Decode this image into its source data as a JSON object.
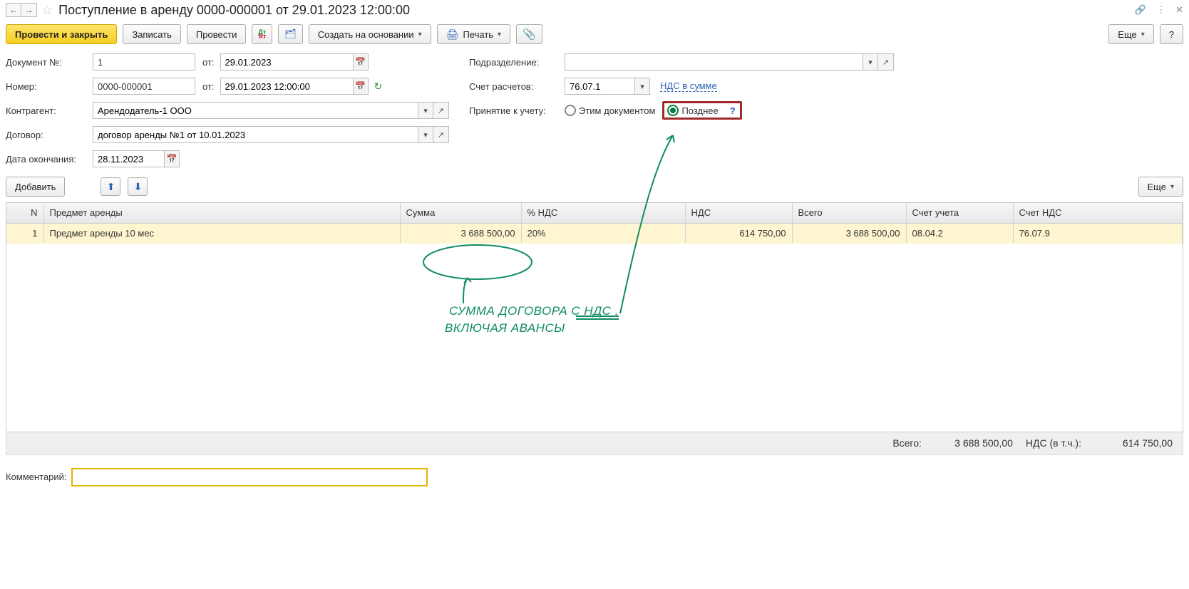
{
  "title": "Поступление в аренду 0000-000001 от 29.01.2023 12:00:00",
  "toolbar": {
    "post_close": "Провести и закрыть",
    "save": "Записать",
    "post": "Провести",
    "create_based": "Создать на основании",
    "print": "Печать",
    "more": "Еще",
    "help": "?"
  },
  "form": {
    "doc_no_label": "Документ №:",
    "doc_no": "1",
    "from_label": "от:",
    "doc_date": "29.01.2023",
    "number_label": "Номер:",
    "number": "0000-000001",
    "number_date": "29.01.2023 12:00:00",
    "counterparty_label": "Контрагент:",
    "counterparty": "Арендодатель-1 ООО",
    "contract_label": "Договор:",
    "contract": "договор аренды №1 от 10.01.2023",
    "end_date_label": "Дата окончания:",
    "end_date": "28.11.2023",
    "division_label": "Подразделение:",
    "division": "",
    "account_label": "Счет расчетов:",
    "account": "76.07.1",
    "vat_link": "НДС в сумме",
    "accept_label": "Принятие к учету:",
    "radio_this_doc": "Этим документом",
    "radio_later": "Позднее"
  },
  "row_toolbar": {
    "add": "Добавить",
    "more": "Еще"
  },
  "grid": {
    "cols": {
      "n": "N",
      "subject": "Предмет аренды",
      "sum": "Сумма",
      "vat_pct": "% НДС",
      "vat": "НДС",
      "total": "Всего",
      "acc": "Счет учета",
      "vat_acc": "Счет НДС"
    },
    "rows": [
      {
        "n": "1",
        "subject": "Предмет аренды 10 мес",
        "sum": "3 688 500,00",
        "vat_pct": "20%",
        "vat": "614 750,00",
        "total": "3 688 500,00",
        "acc": "08.04.2",
        "vat_acc": "76.07.9"
      }
    ]
  },
  "totals": {
    "total_label": "Всего:",
    "total": "3 688 500,00",
    "vat_label": "НДС (в т.ч.):",
    "vat": "614 750,00"
  },
  "comment_label": "Комментарий:",
  "comment": "",
  "annotation": {
    "line1": "СУММА  ДОГОВОРА  С НДС ,",
    "line2": "ВКЛЮЧАЯ  АВАНСЫ"
  }
}
